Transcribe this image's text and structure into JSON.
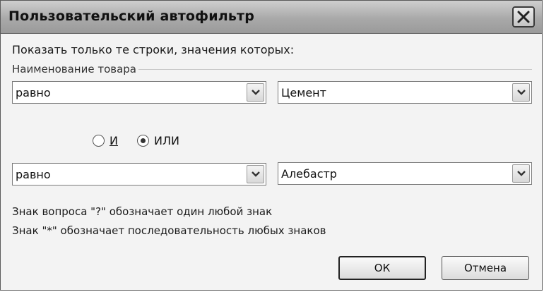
{
  "window": {
    "title": "Пользовательский автофильтр"
  },
  "prompt": "Показать только те строки, значения которых:",
  "field_label": "Наименование товара",
  "condition1": {
    "operator": "равно",
    "value": "Цемент"
  },
  "logic": {
    "and_label": "И",
    "or_label": "ИЛИ",
    "selected": "ИЛИ"
  },
  "condition2": {
    "operator": "равно",
    "value": "Алебастр"
  },
  "hints": {
    "question": "Знак вопроса \"?\" обозначает один любой знак",
    "asterisk": "Знак \"*\" обозначает последовательность любых знаков"
  },
  "buttons": {
    "ok": "ОК",
    "cancel": "Отмена"
  },
  "icons": {
    "close": "close-icon",
    "dropdown": "chevron-down-icon"
  }
}
